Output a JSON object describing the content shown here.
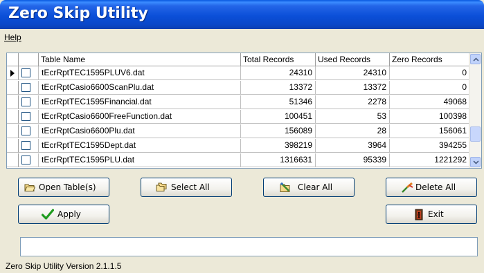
{
  "window": {
    "title": "Zero Skip Utility"
  },
  "menu": {
    "help_label": "Help"
  },
  "table": {
    "columns": [
      "Table Name",
      "Total Records",
      "Used Records",
      "Zero Records"
    ],
    "rows": [
      {
        "name": "tEcrRptTEC1595PLUV6.dat",
        "total": "24310",
        "used": "24310",
        "zero": "0"
      },
      {
        "name": "tEcrRptCasio6600ScanPlu.dat",
        "total": "13372",
        "used": "13372",
        "zero": "0"
      },
      {
        "name": "tEcrRptTEC1595Financial.dat",
        "total": "51346",
        "used": "2278",
        "zero": "49068"
      },
      {
        "name": "tEcrRptCasio6600FreeFunction.dat",
        "total": "100451",
        "used": "53",
        "zero": "100398"
      },
      {
        "name": "tEcrRptCasio6600Plu.dat",
        "total": "156089",
        "used": "28",
        "zero": "156061"
      },
      {
        "name": "tEcrRptTEC1595Dept.dat",
        "total": "398219",
        "used": "3964",
        "zero": "394255"
      },
      {
        "name": "tEcrRptTEC1595PLU.dat",
        "total": "1316631",
        "used": "95339",
        "zero": "1221292"
      }
    ]
  },
  "buttons": {
    "open_tables": "Open Table(s)",
    "select_all": "Select All",
    "clear_all": "Clear All",
    "delete_all": "Delete All",
    "apply": "Apply",
    "exit": "Exit"
  },
  "status": {
    "message": "",
    "version": "Zero Skip Utility Version  2.1.1.5"
  },
  "colors": {
    "title_bar": "#0a47c8",
    "window_bg": "#ece9d8",
    "apply_check": "#1e9b1e"
  }
}
